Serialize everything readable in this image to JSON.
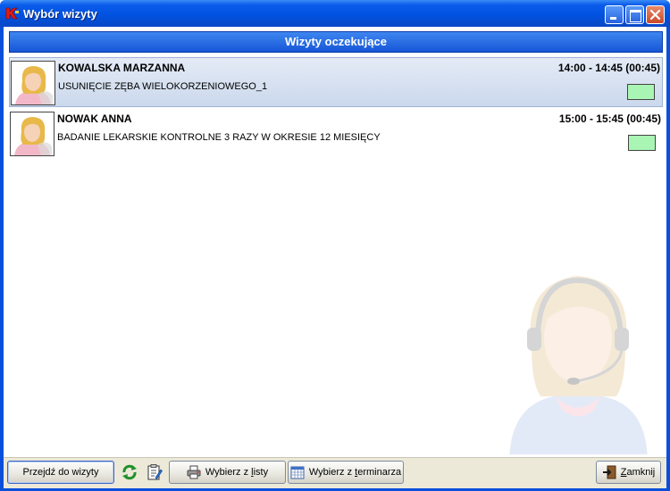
{
  "window": {
    "title": "Wybór wizyty"
  },
  "header": {
    "title": "Wizyty oczekujące"
  },
  "visits": [
    {
      "name": "KOWALSKA MARZANNA",
      "time": "14:00 - 14:45 (00:45)",
      "description": "USUNIĘCIE ZĘBA WIELOKORZENIOWEGO_1",
      "status_color": "#a9f5b4",
      "selected": true
    },
    {
      "name": "NOWAK ANNA",
      "time": "15:00 - 15:45 (00:45)",
      "description": "BADANIE LEKARSKIE KONTROLNE 3 RAZY W OKRESIE 12 MIESIĘCY",
      "status_color": "#a9f5b4",
      "selected": false
    }
  ],
  "toolbar": {
    "go_label": "Przejdź do wizyty",
    "refresh_icon": "refresh-icon",
    "document_icon": "document-icon",
    "list_label_pre": "Wybierz z ",
    "list_label_key": "l",
    "list_label_post": "isty",
    "calendar_label_pre": "Wybierz z ",
    "calendar_label_key": "t",
    "calendar_label_post": "erminarza",
    "close_label_pre": "",
    "close_label_key": "Z",
    "close_label_post": "amknij"
  },
  "colors": {
    "titlebar": "#0152e0",
    "header": "#1f63dd",
    "selected_row": "#d6e0f0",
    "status_green": "#a9f5b4"
  }
}
